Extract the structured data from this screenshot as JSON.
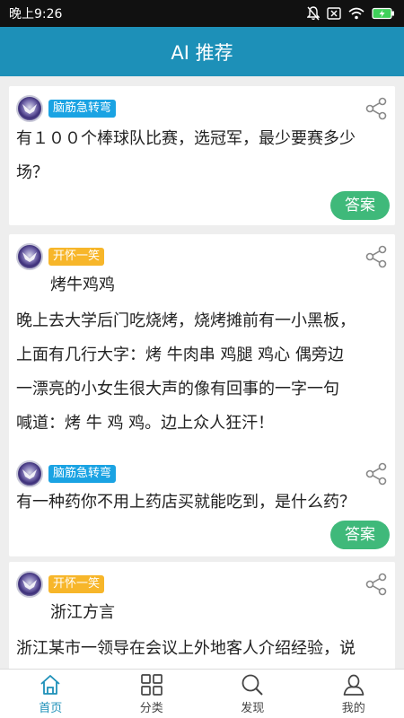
{
  "status": {
    "time": "晚上9:26"
  },
  "header": {
    "title": "AI 推荐"
  },
  "cards": [
    {
      "tag": "脑筋急转弯",
      "tag_color": "#1aa3e3",
      "lines": [
        "有１００个棒球队比赛，选冠军，最少要赛多少",
        "场？"
      ],
      "answer_label": "答案"
    },
    {
      "tag": "开怀一笑",
      "tag_color": "#f7b62a",
      "title": "烤牛鸡鸡",
      "lines": [
        "晚上去大学后门吃烧烤，烧烤摊前有一小黑板，",
        "上面有几行大字：烤 牛肉串 鸡腿 鸡心 偶旁边",
        "一漂亮的小女生很大声的像有回事的一字一句",
        "喊道：烤 牛 鸡 鸡。边上众人狂汗！"
      ]
    },
    {
      "tag": "脑筋急转弯",
      "tag_color": "#1aa3e3",
      "lines": [
        "有一种药你不用上药店买就能吃到，是什么药？"
      ],
      "answer_label": "答案"
    },
    {
      "tag": "开怀一笑",
      "tag_color": "#f7b62a",
      "title": "浙江方言",
      "lines": [
        "浙江某市一领导在会议上外地客人介绍经验，说"
      ]
    }
  ],
  "tabs": [
    {
      "label": "首页",
      "icon": "home-icon",
      "active": true
    },
    {
      "label": "分类",
      "icon": "grid-icon",
      "active": false
    },
    {
      "label": "发现",
      "icon": "search-icon",
      "active": false
    },
    {
      "label": "我的",
      "icon": "user-icon",
      "active": false
    }
  ],
  "colors": {
    "header": "#1d90b8",
    "answer": "#3fb97a",
    "active_tab": "#1d90b8"
  }
}
